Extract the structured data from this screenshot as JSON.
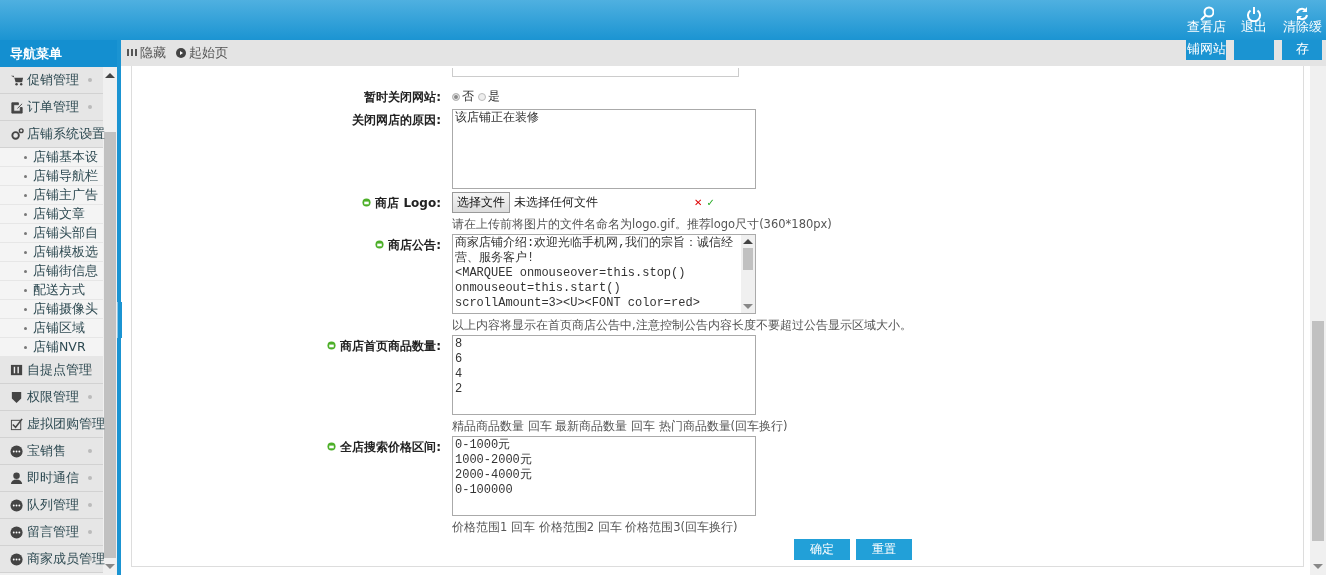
{
  "header": {
    "actions": [
      {
        "label": "查看店铺网站"
      },
      {
        "label": "退出"
      },
      {
        "label": "清除缓存"
      }
    ]
  },
  "sidebar": {
    "title": "导航菜单",
    "items": [
      {
        "label": "促销管理",
        "expanded": false
      },
      {
        "label": "订单管理",
        "expanded": false
      },
      {
        "label": "店铺系统设置",
        "expanded": true,
        "children": [
          {
            "label": "店铺基本设"
          },
          {
            "label": "店铺导航栏"
          },
          {
            "label": "店铺主广告"
          },
          {
            "label": "店铺文章"
          },
          {
            "label": "店铺头部自"
          },
          {
            "label": "店铺模板选"
          },
          {
            "label": "店铺街信息"
          },
          {
            "label": "配送方式"
          },
          {
            "label": "店铺摄像头"
          },
          {
            "label": "店铺区域"
          },
          {
            "label": "店铺NVR"
          }
        ]
      },
      {
        "label": "自提点管理",
        "expanded": false
      },
      {
        "label": "权限管理",
        "expanded": false
      },
      {
        "label": "虚拟团购管理",
        "expanded": false
      },
      {
        "label": "宝销售",
        "expanded": false
      },
      {
        "label": "即时通信",
        "expanded": false
      },
      {
        "label": "队列管理",
        "expanded": false
      },
      {
        "label": "留言管理",
        "expanded": false
      },
      {
        "label": "商家成员管理",
        "expanded": false
      }
    ]
  },
  "toolbar": [
    {
      "label": "隐藏"
    },
    {
      "label": "起始页"
    }
  ],
  "form": {
    "rows": [
      {
        "kind": "radio",
        "label": "暂时关闭网站:",
        "marked": false,
        "options": [
          {
            "label": "否",
            "selected": true
          },
          {
            "label": "是",
            "selected": false
          }
        ]
      },
      {
        "kind": "textarea",
        "label": "关闭网店的原因:",
        "marked": false,
        "value": "该店铺正在装修"
      },
      {
        "kind": "file",
        "label": "商店 Logo:",
        "marked": true,
        "button": "选择文件",
        "value": "未选择任何文件",
        "marks": [
          "✕",
          "✓"
        ],
        "hint": "请在上传前将图片的文件名命名为logo.gif。推荐logo尺寸(360*180px)"
      },
      {
        "kind": "textarea",
        "label": "商店公告:",
        "marked": true,
        "scroll": true,
        "value": "商家店铺介绍:欢迎光临手机网,我们的宗旨：诚信经营、服务客户!\n<MARQUEE onmouseover=this.stop()\nonmouseout=this.start()\nscrollAmount=3><U><FONT color=red>",
        "hint": "以上内容将显示在首页商店公告中,注意控制公告内容长度不要超过公告显示区域大小。"
      },
      {
        "kind": "textarea",
        "label": "商店首页商品数量:",
        "marked": true,
        "value": "8\n6\n4\n2",
        "hint": "精品商品数量 回车 最新商品数量 回车 热门商品数量(回车换行)"
      },
      {
        "kind": "textarea",
        "label": "全店搜索价格区间:",
        "marked": true,
        "value": "0-1000元\n1000-2000元\n2000-4000元\n0-100000",
        "hint": "价格范围1 回车 价格范围2 回车 价格范围3(回车换行)"
      }
    ],
    "buttons": [
      {
        "label": "确定"
      },
      {
        "label": "重置"
      }
    ]
  }
}
